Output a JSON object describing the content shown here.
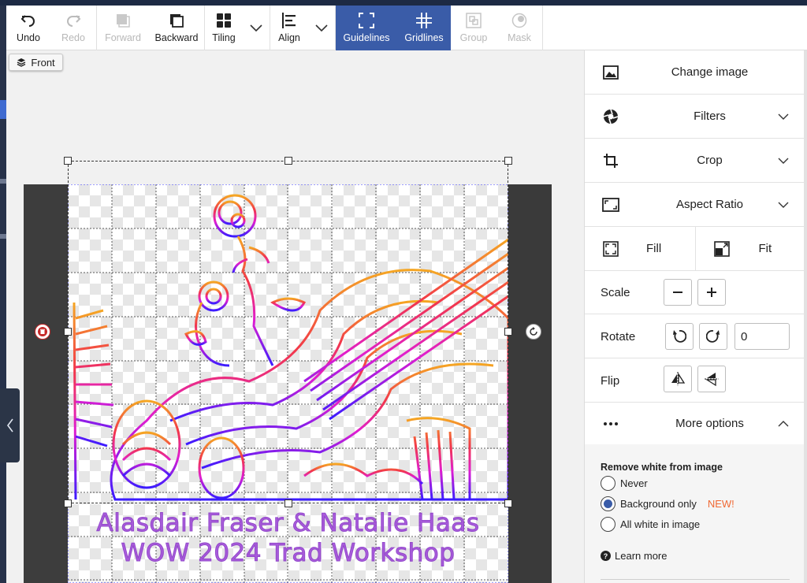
{
  "toolbar": {
    "undo": "Undo",
    "redo": "Redo",
    "forward": "Forward",
    "backward": "Backward",
    "tiling": "Tiling",
    "align": "Align",
    "guidelines": "Guidelines",
    "gridlines": "Gridlines",
    "group": "Group",
    "mask": "Mask"
  },
  "canvas": {
    "front_label": "Front",
    "caption_line1": "Alasdair Fraser & Natalie Haas",
    "caption_line2": "WOW 2024 Trad Workshop"
  },
  "panel": {
    "change_image": "Change image",
    "filters": "Filters",
    "crop": "Crop",
    "aspect_ratio": "Aspect Ratio",
    "fill": "Fill",
    "fit": "Fit",
    "scale": "Scale",
    "rotate": "Rotate",
    "rotate_value": "0",
    "flip": "Flip",
    "more_options": "More options",
    "remove_white": {
      "title": "Remove white from image",
      "options": [
        "Never",
        "Background only",
        "All white in image"
      ],
      "selected": "Background only",
      "new_badge": "NEW!"
    },
    "learn_more": "Learn more"
  },
  "colors": {
    "accent": "#3a5ca8",
    "new_badge": "#f06a35",
    "caption": "#a24fd8"
  }
}
